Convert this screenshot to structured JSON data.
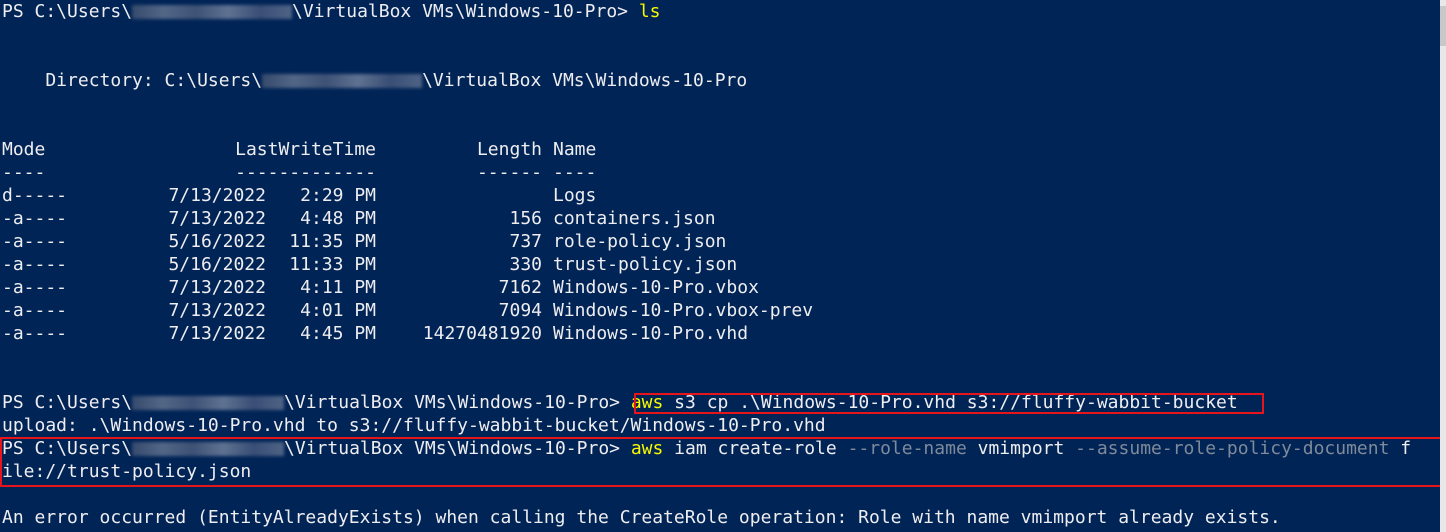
{
  "prompt1": {
    "ps": "PS C:\\Users\\",
    "path": "\\VirtualBox VMs\\Windows-10-Pro> ",
    "cmd": "ls"
  },
  "directory": {
    "label": "    Directory: C:\\Users\\",
    "path": "\\VirtualBox VMs\\Windows-10-Pro"
  },
  "listing": {
    "headers": {
      "mode": "Mode",
      "lastwrite": "LastWriteTime",
      "length": "Length",
      "name": "Name"
    },
    "underline": {
      "mode": "----",
      "lastwrite": "-------------",
      "length": "------",
      "name": "----"
    },
    "rows": [
      {
        "mode": "d-----",
        "date": "7/13/2022",
        "time": "2:29 PM",
        "length": "",
        "name": "Logs"
      },
      {
        "mode": "-a----",
        "date": "7/13/2022",
        "time": "4:48 PM",
        "length": "156",
        "name": "containers.json"
      },
      {
        "mode": "-a----",
        "date": "5/16/2022",
        "time": "11:35 PM",
        "length": "737",
        "name": "role-policy.json"
      },
      {
        "mode": "-a----",
        "date": "5/16/2022",
        "time": "11:33 PM",
        "length": "330",
        "name": "trust-policy.json"
      },
      {
        "mode": "-a----",
        "date": "7/13/2022",
        "time": "4:11 PM",
        "length": "7162",
        "name": "Windows-10-Pro.vbox"
      },
      {
        "mode": "-a----",
        "date": "7/13/2022",
        "time": "4:01 PM",
        "length": "7094",
        "name": "Windows-10-Pro.vbox-prev"
      },
      {
        "mode": "-a----",
        "date": "7/13/2022",
        "time": "4:45 PM",
        "length": "14270481920",
        "name": "Windows-10-Pro.vhd"
      }
    ]
  },
  "prompt2": {
    "ps": "PS C:\\Users\\",
    "path": "\\VirtualBox VMs\\Windows-10-Pro> ",
    "cmd_aws": "aws",
    "cmd_rest": " s3 cp .\\Windows-10-Pro.vhd s3://fluffy-wabbit-bucket"
  },
  "upload_line": "upload: .\\Windows-10-Pro.vhd to s3://fluffy-wabbit-bucket/Windows-10-Pro.vhd",
  "prompt3": {
    "ps": "PS C:\\Users\\",
    "path": "\\VirtualBox VMs\\Windows-10-Pro> ",
    "aws": "aws",
    "sub": " iam create-role ",
    "p1": "--role-name",
    "v1": " vmimport ",
    "p2": "--assume-role-policy-document",
    "v2a": " f",
    "wrap": "ile://trust-policy.json"
  },
  "error_line": "An error occurred (EntityAlreadyExists) when calling the CreateRole operation: Role with name vmimport already exists.",
  "colors": {
    "background": "#012456",
    "text": "#eeedf0",
    "command": "#f8f800",
    "parameter": "#7f8a9a",
    "highlight_box": "#e8141c"
  }
}
